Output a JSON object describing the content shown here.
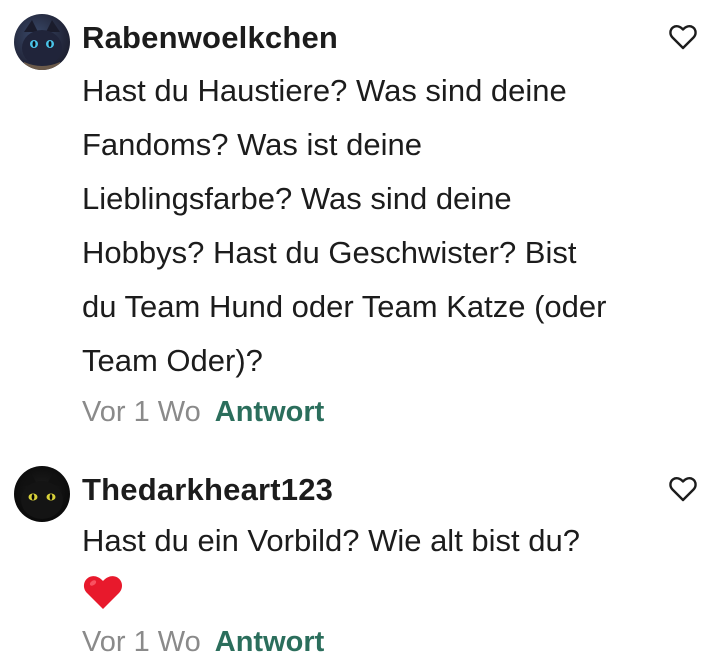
{
  "comments": [
    {
      "username": "Rabenwoelkchen",
      "text": "Hast du Haustiere? Was sind deine\nFandoms? Was ist deine\nLieblingsfarbe? Was sind deine\nHobbys? Hast du Geschwister?  Bist\ndu Team Hund oder Team Katze (oder\nTeam Oder)?",
      "time": "Vor 1 Wo",
      "reply_label": "Antwort",
      "avatar_icon": "cat-avatar-icon"
    },
    {
      "username": "Thedarkheart123",
      "text": "Hast du ein Vorbild? Wie alt bist du?",
      "emoji": "red-heart-emoji",
      "time": "Vor 1 Wo",
      "reply_label": "Antwort",
      "avatar_icon": "black-cat-avatar-icon"
    }
  ],
  "colors": {
    "reply": "#2b6e5c",
    "time": "#8a8a8a",
    "heart_emoji": "#e8192c"
  },
  "icons": {
    "like": "heart-outline-icon"
  }
}
